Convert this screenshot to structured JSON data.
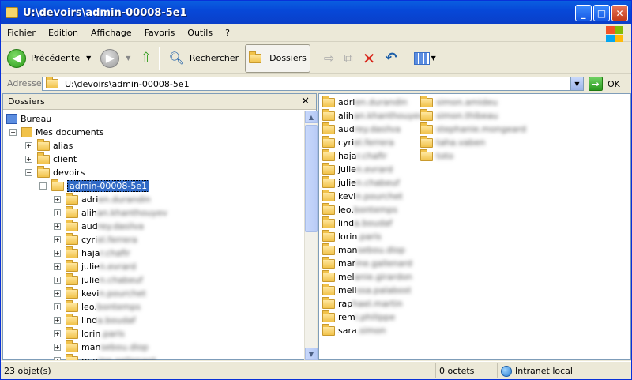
{
  "window": {
    "title": "U:\\devoirs\\admin-00008-5e1"
  },
  "menu": [
    "Fichier",
    "Edition",
    "Affichage",
    "Favoris",
    "Outils",
    "?"
  ],
  "toolbar": {
    "back_label": "Précédente",
    "search_label": "Rechercher",
    "folders_label": "Dossiers"
  },
  "address": {
    "label": "Adresse",
    "path": "U:\\devoirs\\admin-00008-5e1",
    "go_label": "OK"
  },
  "folders_pane": {
    "title": "Dossiers",
    "desktop": "Bureau",
    "mydocs": "Mes documents",
    "level1": [
      "alias",
      "client",
      "devoirs"
    ],
    "selected": "admin-00008-5e1",
    "children": [
      {
        "vis": "adri",
        "blur": "en.durandin"
      },
      {
        "vis": "alih",
        "blur": "an.khanthouyev"
      },
      {
        "vis": "aud",
        "blur": "rey.dasilva"
      },
      {
        "vis": "cyri",
        "blur": "el.ferrera"
      },
      {
        "vis": "haja",
        "blur": "r.chafir"
      },
      {
        "vis": "julie",
        "blur": "n.evrard"
      },
      {
        "vis": "julie",
        "blur": "n.chabeuf"
      },
      {
        "vis": "kevi",
        "blur": "n.pourchet"
      },
      {
        "vis": "leo.",
        "blur": "bontemps"
      },
      {
        "vis": "lind",
        "blur": "a.boudaf"
      },
      {
        "vis": "lorin",
        "blur": ".paris"
      },
      {
        "vis": "man",
        "blur": "sebou.diop"
      },
      {
        "vis": "mar",
        "blur": "ine.gallenard"
      }
    ]
  },
  "contents": {
    "col1": [
      {
        "vis": "adri",
        "blur": "en.durandin"
      },
      {
        "vis": "alih",
        "blur": "an.khanthouyev"
      },
      {
        "vis": "aud",
        "blur": "rey.dasilva"
      },
      {
        "vis": "cyri",
        "blur": "el.ferrera"
      },
      {
        "vis": "haja",
        "blur": "r.chafir"
      },
      {
        "vis": "julie",
        "blur": "n.evrard"
      },
      {
        "vis": "julie",
        "blur": "n.chabeuf"
      },
      {
        "vis": "kevi",
        "blur": "n.pourchet"
      },
      {
        "vis": "leo.",
        "blur": "bontemps"
      },
      {
        "vis": "lind",
        "blur": "a.boudaf"
      },
      {
        "vis": "lorin",
        "blur": ".paris"
      },
      {
        "vis": "man",
        "blur": "sebou.diop"
      },
      {
        "vis": "mar",
        "blur": "ine.gallenard"
      },
      {
        "vis": "mel",
        "blur": "anie.girardon"
      },
      {
        "vis": "meli",
        "blur": "ssa.palabost"
      },
      {
        "vis": "rap",
        "blur": "hael.martin"
      },
      {
        "vis": "rem",
        "blur": "i.philippe"
      },
      {
        "vis": "sara",
        "blur": ".simon"
      }
    ],
    "col2": [
      {
        "vis": "",
        "blur": "simon.amideu"
      },
      {
        "vis": "",
        "blur": "simon.thibeau"
      },
      {
        "vis": "",
        "blur": "stephanie.mongeard"
      },
      {
        "vis": "",
        "blur": "taha.vaben"
      },
      {
        "vis": "",
        "blur": "toto"
      }
    ]
  },
  "status": {
    "count": "23 objet(s)",
    "size": "0 octets",
    "zone": "Intranet local"
  }
}
